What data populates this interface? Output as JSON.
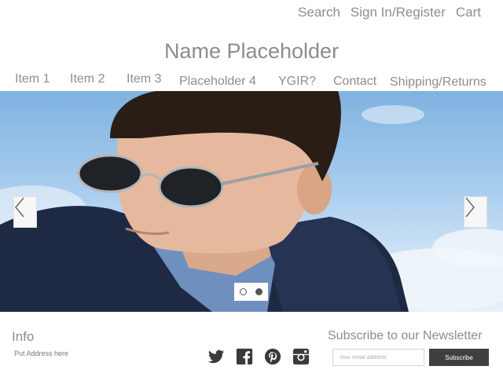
{
  "header": {
    "links": [
      "Search",
      "Sign In/Register",
      "Cart"
    ]
  },
  "brand": {
    "name": "Name Placeholder"
  },
  "nav": {
    "items": [
      "Item 1",
      "Item 2",
      "Item 3",
      "Placeholder 4",
      "YGIR?",
      "Contact",
      "Shipping/Returns"
    ]
  },
  "hero": {
    "prev_icon": "chevron-left-icon",
    "next_icon": "chevron-right-icon",
    "slide_count": 2,
    "active_slide": 2
  },
  "footer": {
    "info_title": "Info",
    "address": "Put Address here",
    "social": [
      "twitter-icon",
      "facebook-icon",
      "pinterest-icon",
      "instagram-icon"
    ],
    "newsletter_title": "Subscribe to our Newsletter",
    "email_placeholder": "Your email address",
    "subscribe_label": "Subscribe"
  }
}
